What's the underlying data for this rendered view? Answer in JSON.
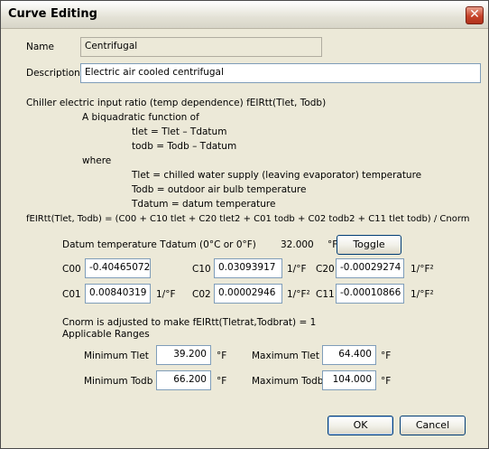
{
  "window": {
    "title": "Curve Editing",
    "close_glyph": "✕"
  },
  "name": {
    "label": "Name",
    "value": "Centrifugal"
  },
  "description": {
    "label": "Description",
    "value": "Electric air cooled centrifugal"
  },
  "explanation": {
    "line1": "Chiller electric input ratio (temp dependence) fEIRtt(Tlet, Todb)",
    "line2": "A biquadratic function of",
    "line3": "tlet = Tlet – Tdatum",
    "line4": "todb = Todb – Tdatum",
    "line5": "where",
    "line6": "Tlet = chilled water supply (leaving evaporator) temperature",
    "line7": "Todb = outdoor air bulb temperature",
    "line8": "Tdatum = datum temperature",
    "formula": "fEIRtt(Tlet, Todb) = (C00 + C10 tlet + C20 tlet2 + C01 todb + C02 todb2 + C11 tlet todb) / Cnorm"
  },
  "datum": {
    "label": "Datum temperature Tdatum  (0°C or 0°F)",
    "value": "32.000",
    "unit": "°F",
    "toggle_label": "Toggle"
  },
  "coefficients": {
    "c00": {
      "label": "C00",
      "value": "-0.40465072",
      "unit": ""
    },
    "c10": {
      "label": "C10",
      "value": "0.03093917",
      "unit": "1/°F"
    },
    "c20": {
      "label": "C20",
      "value": "-0.00029274",
      "unit": "1/°F²"
    },
    "c01": {
      "label": "C01",
      "value": "0.00840319",
      "unit": "1/°F"
    },
    "c02": {
      "label": "C02",
      "value": "0.00002946",
      "unit": "1/°F²"
    },
    "c11": {
      "label": "C11",
      "value": "-0.00010866",
      "unit": "1/°F²"
    }
  },
  "cnorm_note": "Cnorm is adjusted to make fEIRtt(Tletrat,Todbrat) = 1",
  "ranges": {
    "heading": "Applicable Ranges",
    "min_tlet": {
      "label": "Minimum Tlet",
      "value": "39.200",
      "unit": "°F"
    },
    "max_tlet": {
      "label": "Maximum Tlet",
      "value": "64.400",
      "unit": "°F"
    },
    "min_todb": {
      "label": "Minimum Todb",
      "value": "66.200",
      "unit": "°F"
    },
    "max_todb": {
      "label": "Maximum Todb",
      "value": "104.000",
      "unit": "°F"
    }
  },
  "buttons": {
    "ok": "OK",
    "cancel": "Cancel"
  }
}
